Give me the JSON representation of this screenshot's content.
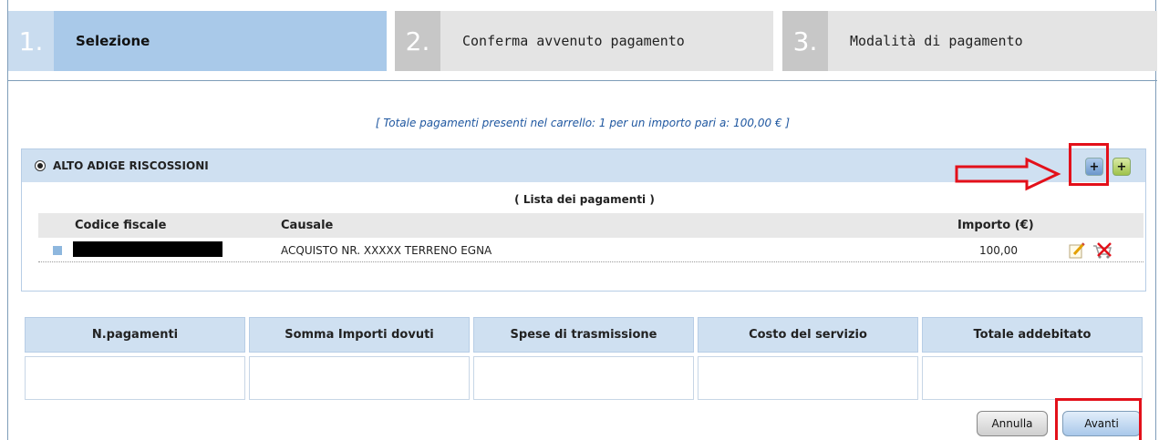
{
  "steps": [
    {
      "num": "1.",
      "label": "Selezione"
    },
    {
      "num": "2.",
      "label": "Conferma avvenuto pagamento"
    },
    {
      "num": "3.",
      "label": "Modalità di pagamento"
    }
  ],
  "summary": "[ Totale pagamenti presenti nel carrello: 1 per un importo pari a: 100,00 € ]",
  "entity": {
    "name": "ALTO ADIGE RISCOSSIONI",
    "list_title": "( Lista dei pagamenti )",
    "columns": {
      "codice": "Codice fiscale",
      "causale": "Causale",
      "importo": "Importo (€)"
    },
    "rows": [
      {
        "codice": "",
        "causale": "ACQUISTO NR. XXXXX TERRENO EGNA",
        "importo": "100,00"
      }
    ],
    "add_blue_label": "+",
    "add_green_label": "+"
  },
  "totals": {
    "headers": [
      "N.pagamenti",
      "Somma Importi dovuti",
      "Spese di trasmissione",
      "Costo del servizio",
      "Totale addebitato"
    ]
  },
  "buttons": {
    "annulla": "Annulla",
    "avanti": "Avanti"
  },
  "colors": {
    "highlight": "#e3101a",
    "active_step": "#a9c9e9",
    "header": "#cfe0f1"
  },
  "icons": {
    "edit": "edit-icon",
    "remove_cart": "remove-from-cart-icon"
  }
}
